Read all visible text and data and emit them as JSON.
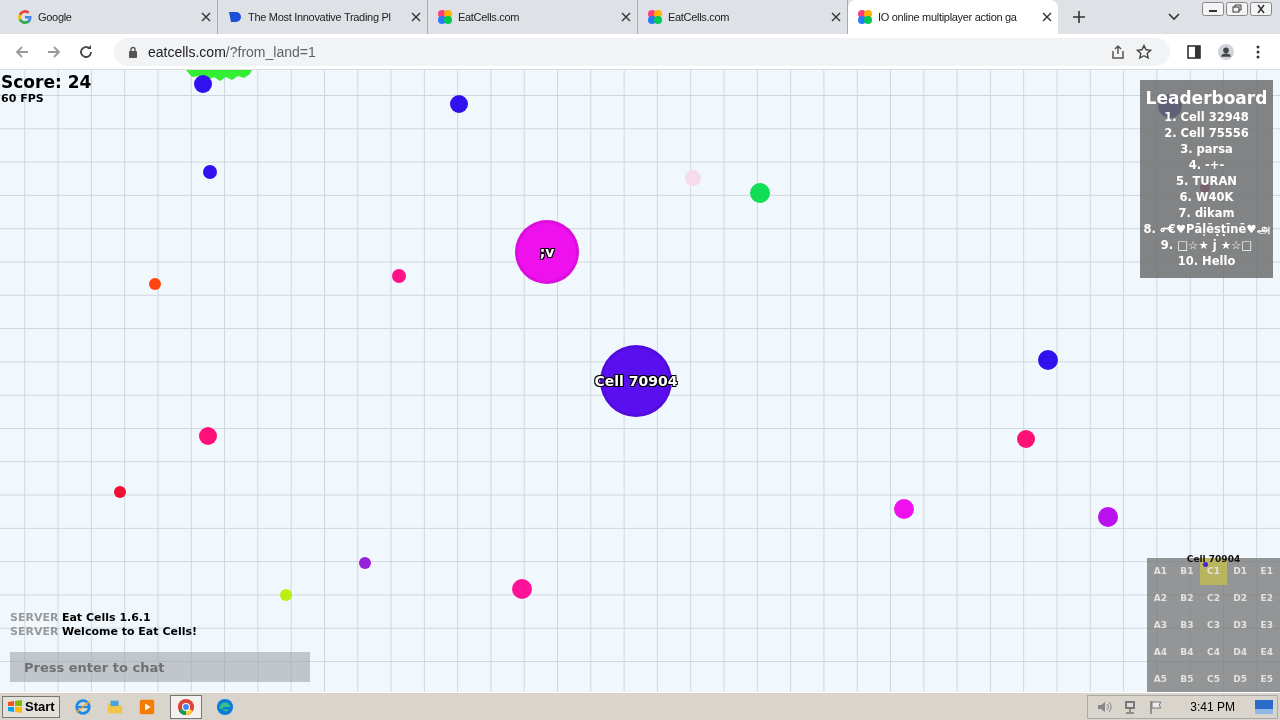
{
  "browser": {
    "tabs": [
      {
        "title": "Google",
        "selected": false
      },
      {
        "title": "The Most Innovative Trading Pl",
        "selected": false
      },
      {
        "title": "EatCells.com",
        "selected": false
      },
      {
        "title": "EatCells.com",
        "selected": false
      },
      {
        "title": "IO online multiplayer action ga",
        "selected": true
      }
    ],
    "address": {
      "domain": "eatcells.com",
      "path": "/?from_land=1"
    }
  },
  "game": {
    "score": "Score: 24",
    "fps": "60 FPS",
    "cells": [
      {
        "name": ";v",
        "color": "#ee11ee"
      },
      {
        "name": "Cell 70904",
        "color": "#5a0ff0"
      }
    ],
    "leaderboard": {
      "title": "Leaderboard",
      "entries": [
        "1. Cell 32948",
        "2. Cell 75556",
        "3. parsa",
        "4. -+-",
        "5. TURAN",
        "6. W40K",
        "7. dikam",
        "8. ൳€♥Pāļēṣṭīnē♥அ",
        "9. □☆★ j ★☆□",
        "10. Hello"
      ]
    },
    "minimap": {
      "title": "Cell 70904",
      "cells": [
        {
          "label": "A1",
          "selected": false
        },
        {
          "label": "B1",
          "selected": false
        },
        {
          "label": "C1",
          "selected": true
        },
        {
          "label": "D1",
          "selected": false
        },
        {
          "label": "E1",
          "selected": false
        },
        {
          "label": "A2",
          "selected": false
        },
        {
          "label": "B2",
          "selected": false
        },
        {
          "label": "C2",
          "selected": false
        },
        {
          "label": "D2",
          "selected": false
        },
        {
          "label": "E2",
          "selected": false
        },
        {
          "label": "A3",
          "selected": false
        },
        {
          "label": "B3",
          "selected": false
        },
        {
          "label": "C3",
          "selected": false
        },
        {
          "label": "D3",
          "selected": false
        },
        {
          "label": "E3",
          "selected": false
        },
        {
          "label": "A4",
          "selected": false
        },
        {
          "label": "B4",
          "selected": false
        },
        {
          "label": "C4",
          "selected": false
        },
        {
          "label": "D4",
          "selected": false
        },
        {
          "label": "E4",
          "selected": false
        },
        {
          "label": "A5",
          "selected": false
        },
        {
          "label": "B5",
          "selected": false
        },
        {
          "label": "C5",
          "selected": false
        },
        {
          "label": "D5",
          "selected": false
        },
        {
          "label": "E5",
          "selected": false
        }
      ]
    },
    "chat": {
      "messages": [
        {
          "sender": "SERVER",
          "text": "Eat Cells 1.6.1"
        },
        {
          "sender": "SERVER",
          "text": "Welcome to Eat Cells!"
        }
      ],
      "placeholder": "Press enter to chat"
    }
  },
  "taskbar": {
    "start": "Start",
    "time": "3:41 PM"
  }
}
